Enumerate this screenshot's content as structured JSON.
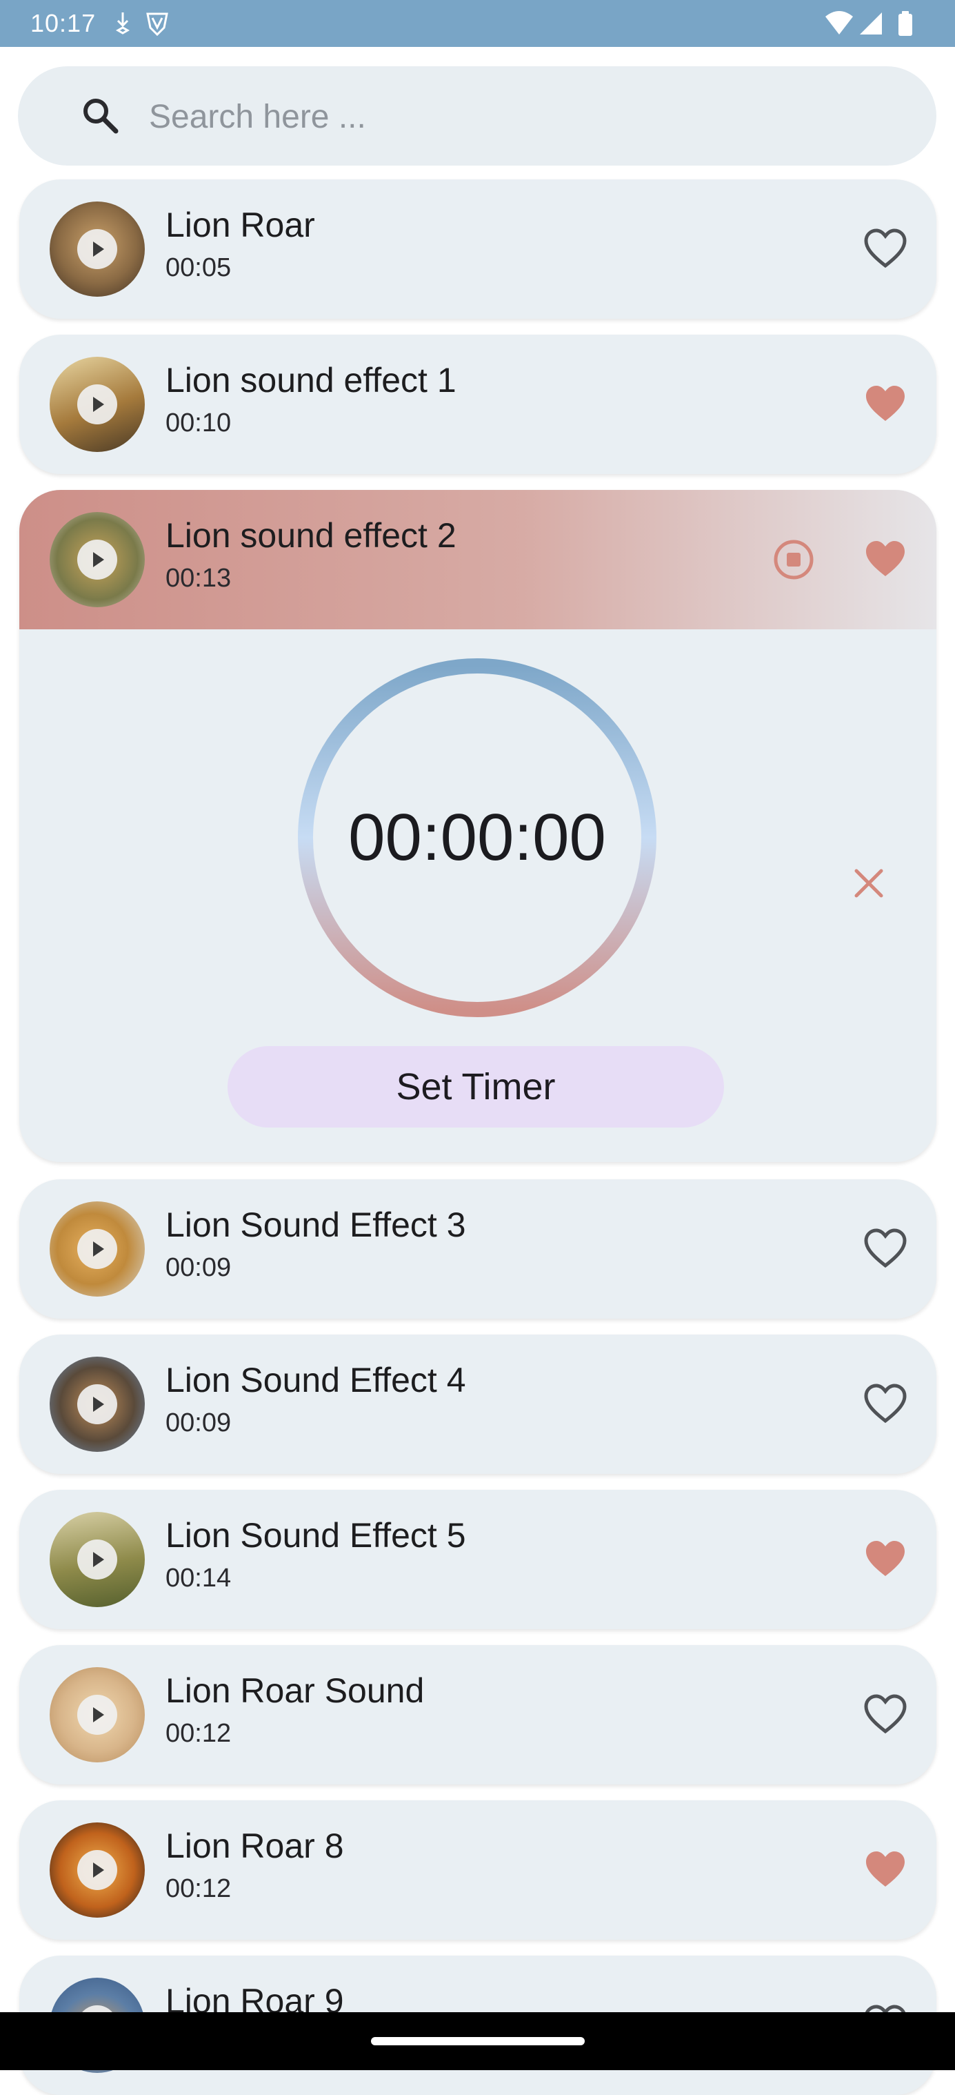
{
  "status_bar": {
    "time": "10:17",
    "left_icons": [
      "download-arrow-icon",
      "shield-v-icon"
    ],
    "right_icons": [
      "wifi-icon",
      "cellular-signal-icon",
      "battery-icon"
    ]
  },
  "search": {
    "placeholder": "Search here ...",
    "icon": "search-icon"
  },
  "colors": {
    "status_bar": "#79a5c6",
    "card_bg": "#e9eff3",
    "heart_filled": "#d4887c",
    "heart_outline": "#4f5256",
    "playing_gradient_start": "#cd8f88",
    "set_timer_button": "#e7ddf6",
    "ring_top": "#7ea7c9",
    "ring_mid": "#c7dcf4",
    "ring_bottom": "#cf8f88"
  },
  "sounds": [
    {
      "title": "Lion Roar",
      "duration": "00:05",
      "favorite": false,
      "thumb_color": "#8a6a44"
    },
    {
      "title": "Lion sound effect 1",
      "duration": "00:10",
      "favorite": true,
      "thumb_color": "#a57a3c"
    },
    {
      "title": "Lion sound effect 2",
      "duration": "00:13",
      "favorite": true,
      "playing": true,
      "thumb_color": "#9a8a5c"
    },
    {
      "title": "Lion Sound Effect 3",
      "duration": "00:09",
      "favorite": false,
      "thumb_color": "#c08a3c"
    },
    {
      "title": "Lion Sound Effect 4",
      "duration": "00:09",
      "favorite": false,
      "thumb_color": "#5a4a3a"
    },
    {
      "title": "Lion Sound Effect 5",
      "duration": "00:14",
      "favorite": true,
      "thumb_color": "#8e8a4a"
    },
    {
      "title": "Lion Roar Sound",
      "duration": "00:12",
      "favorite": false,
      "thumb_color": "#d8b58a"
    },
    {
      "title": "Lion Roar 8",
      "duration": "00:12",
      "favorite": true,
      "thumb_color": "#c0621c"
    },
    {
      "title": "Lion Roar 9",
      "duration": "",
      "favorite": false,
      "thumb_color": "#5c7ea6"
    }
  ],
  "timer": {
    "display": "00:00:00",
    "set_label": "Set Timer",
    "close_icon": "close-icon",
    "stop_icon": "stop-circle-icon"
  }
}
